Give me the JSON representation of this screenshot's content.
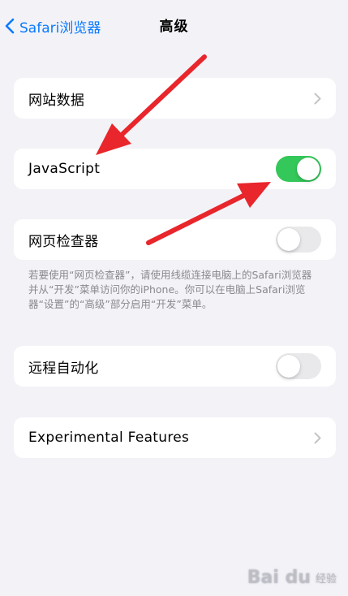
{
  "nav": {
    "back_label": "Safari浏览器",
    "title": "高级"
  },
  "rows": {
    "website_data": {
      "label": "网站数据"
    },
    "javascript": {
      "label": "JavaScript",
      "enabled": true
    },
    "web_inspector": {
      "label": "网页检查器",
      "enabled": false,
      "footnote": "若要使用“网页检查器”，请使用线缆连接电脑上的Safari浏览器并从“开发”菜单访问你的iPhone。你可以在电脑上Safari浏览器“设置”的“高级”部分启用“开发”菜单。"
    },
    "remote_automation": {
      "label": "远程自动化",
      "enabled": false
    },
    "experimental_features": {
      "label": "Experimental Features"
    }
  },
  "icons": {
    "back": "chevron-left-icon",
    "disclosure": "chevron-right-icon",
    "annotation": "red-arrow-icon"
  },
  "colors": {
    "accent": "#0a7aff",
    "toggle_on": "#34c759",
    "toggle_off": "#e9e9eb",
    "background": "#f2f2f7",
    "annotation_arrow": "#e8262b"
  },
  "watermark": {
    "logo": "Bai du",
    "sub": "经验"
  }
}
